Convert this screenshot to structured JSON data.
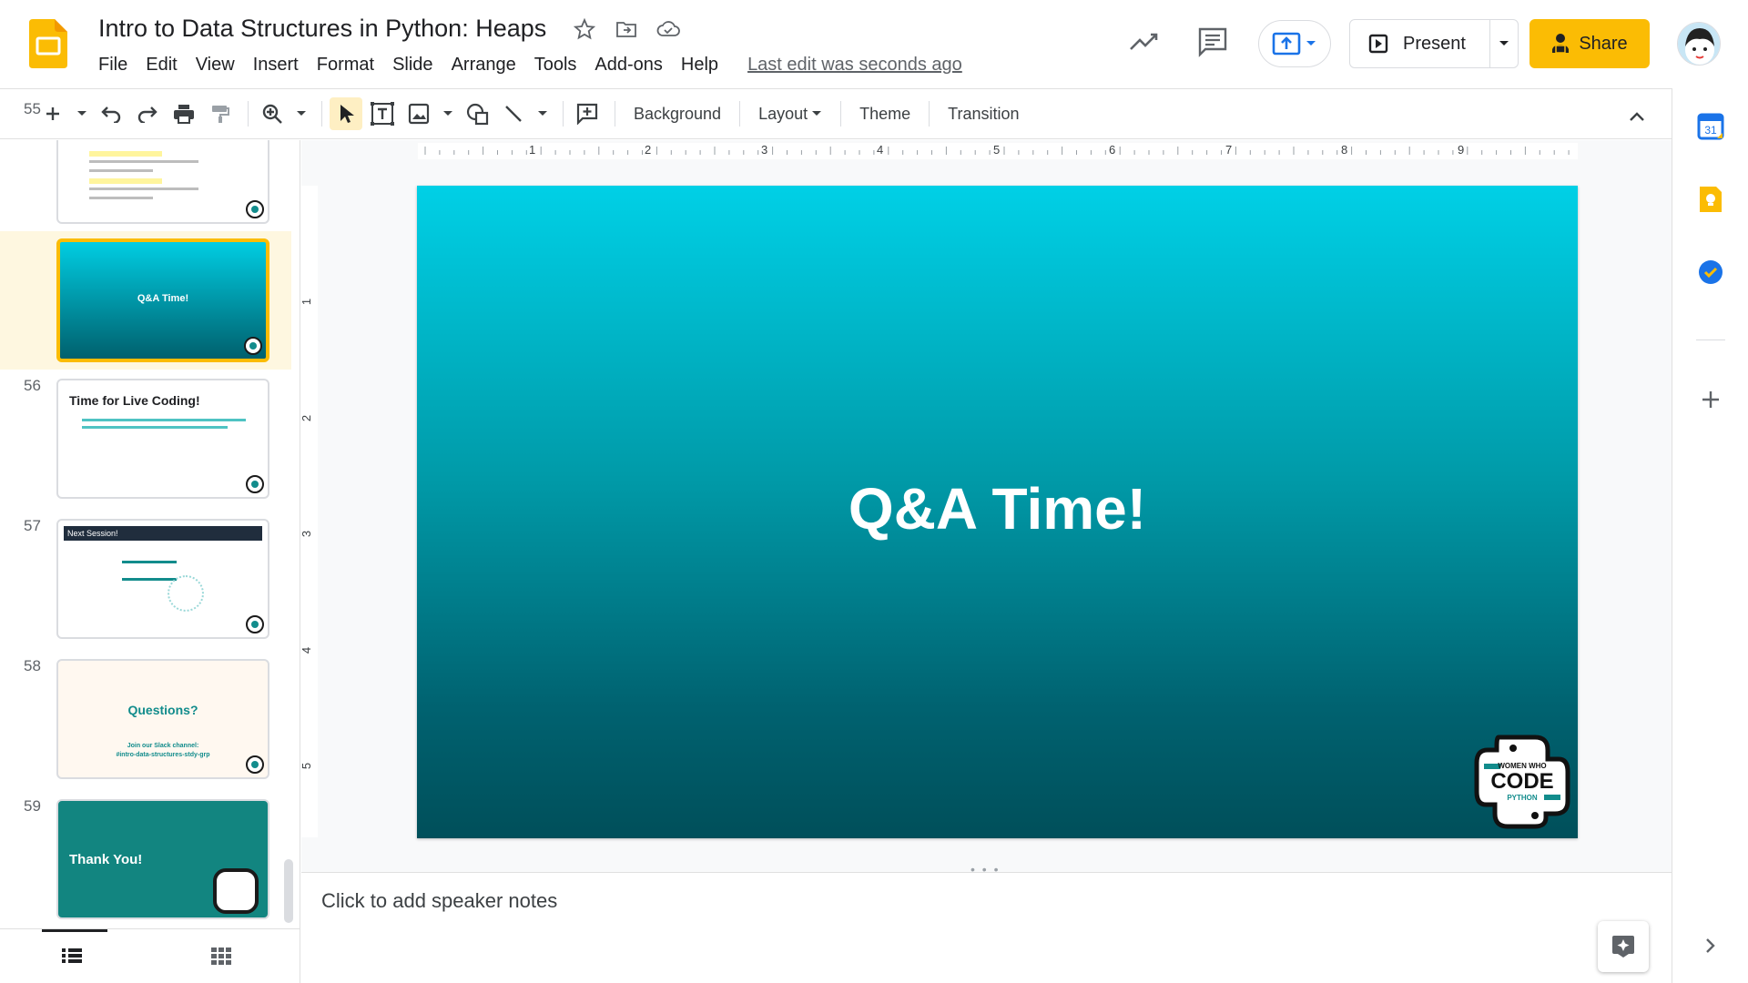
{
  "app": {
    "title": "Intro to Data Structures in Python: Heaps",
    "brand_color": "#fbbc04"
  },
  "menu": {
    "items": [
      "File",
      "Edit",
      "View",
      "Insert",
      "Format",
      "Slide",
      "Arrange",
      "Tools",
      "Add-ons",
      "Help"
    ],
    "last_edit": "Last edit was seconds ago"
  },
  "header": {
    "present_label": "Present",
    "share_label": "Share"
  },
  "toolbar": {
    "background_label": "Background",
    "layout_label": "Layout",
    "theme_label": "Theme",
    "transition_label": "Transition"
  },
  "ruler": {
    "h_labels": [
      "1",
      "2",
      "3",
      "4",
      "5",
      "6",
      "7",
      "8",
      "9"
    ],
    "v_labels": [
      "1",
      "2",
      "3",
      "4",
      "5"
    ]
  },
  "slides": [
    {
      "number": "55",
      "title": "Q&A Time!"
    },
    {
      "number": "56",
      "title": "Time for Live Coding!"
    },
    {
      "number": "57",
      "title": "Next Session!"
    },
    {
      "number": "58",
      "title": "Questions?",
      "subtitle": "Join our Slack channel:",
      "channel": "#intro-data-structures-stdy-grp"
    },
    {
      "number": "59",
      "title": "Thank You!"
    }
  ],
  "current_slide": {
    "heading": "Q&A Time!",
    "logo_top": "WOMEN WHO",
    "logo_main": "CODE",
    "logo_bottom": "PYTHON"
  },
  "notes": {
    "placeholder": "Click to add speaker notes"
  },
  "colors": {
    "accent": "#fbbc04",
    "slide_top": "#00d0e6",
    "slide_bottom": "#004f5a",
    "teal": "#128c8c"
  }
}
